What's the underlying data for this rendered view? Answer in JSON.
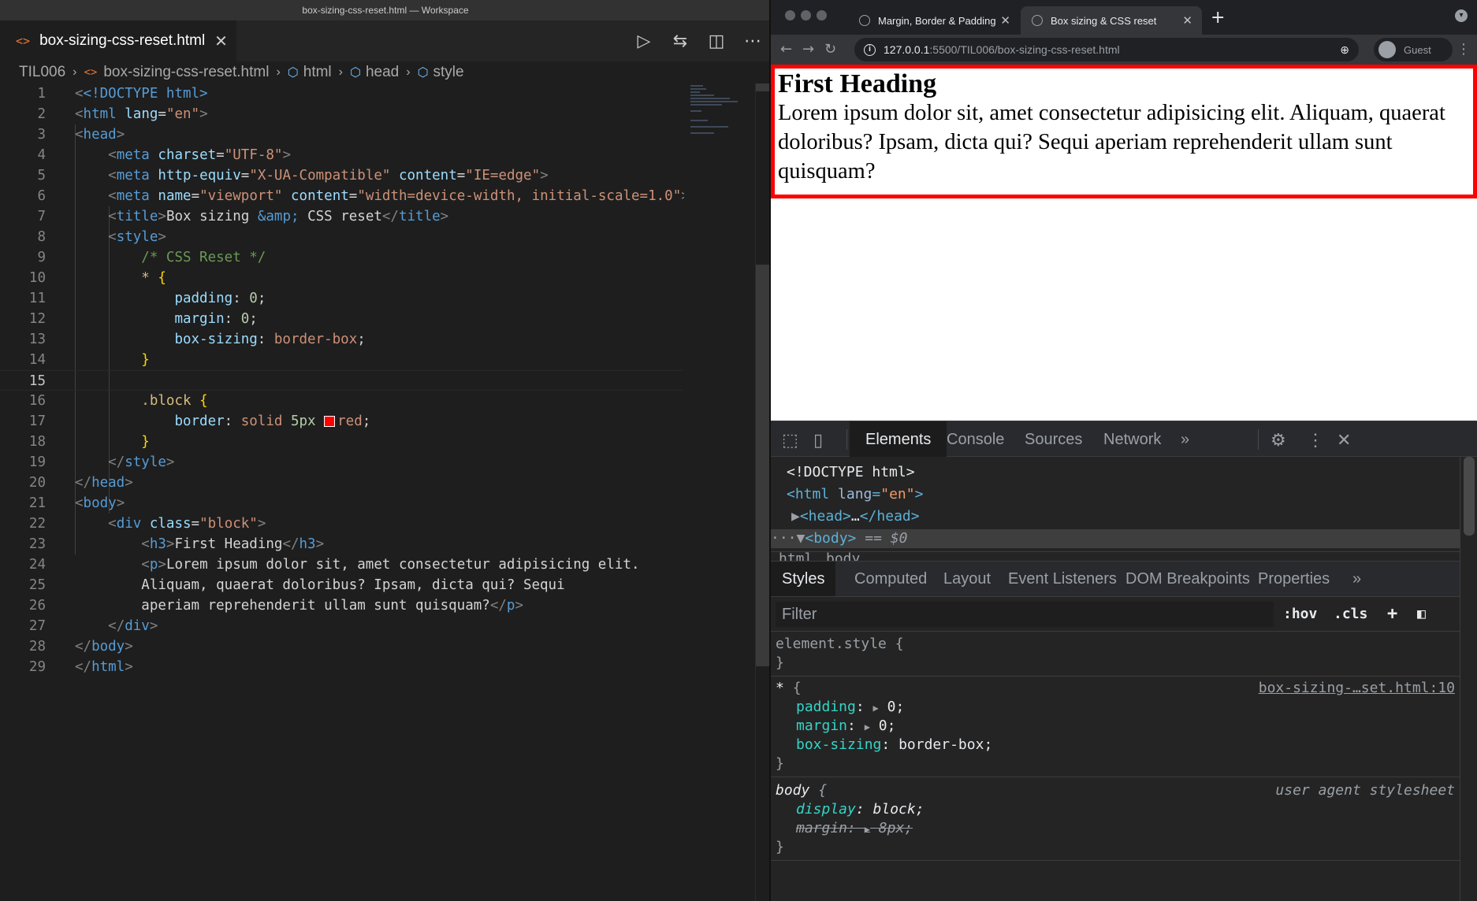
{
  "vscode": {
    "window_title": "box-sizing-css-reset.html — Workspace",
    "tab": {
      "icon": "<>",
      "label": "box-sizing-css-reset.html"
    },
    "breadcrumb": [
      "TIL006",
      "box-sizing-css-reset.html",
      "html",
      "head",
      "style"
    ],
    "current_line": 15,
    "lines": [
      "1",
      "2",
      "3",
      "4",
      "5",
      "6",
      "7",
      "8",
      "9",
      "10",
      "11",
      "12",
      "13",
      "14",
      "15",
      "16",
      "17",
      "18",
      "19",
      "20",
      "21",
      "22",
      "23",
      "24",
      "25",
      "26",
      "27",
      "28",
      "29"
    ],
    "code": {
      "l1": "<!DOCTYPE html>",
      "l2_tag": "html",
      "l2_attr": "lang",
      "l2_val": "\"en\"",
      "l3_tag": "head",
      "l4_attr": "charset",
      "l4_val": "\"UTF-8\"",
      "l5_attr1": "http-equiv",
      "l5_val1": "\"X-UA-Compatible\"",
      "l5_attr2": "content",
      "l5_val2": "\"IE=edge\"",
      "l6_attr1": "name",
      "l6_val1": "\"viewport\"",
      "l6_attr2": "content",
      "l6_val2": "\"width=device-width, initial-scale=1.0\"",
      "l7_text": "Box sizing ",
      "l7_ent": "&amp;",
      "l7_text2": " CSS reset",
      "l9": "/* CSS Reset */",
      "l10": "*",
      "l11_prop": "padding",
      "l11_val": "0",
      "l12_prop": "margin",
      "l12_val": "0",
      "l13_prop": "box-sizing",
      "l13_val": "border-box",
      "l16": ".block",
      "l17_prop": "border",
      "l17_v1": "solid",
      "l17_v2": "5px",
      "l17_v3": "red",
      "l22_attr": "class",
      "l22_val": "\"block\"",
      "l23": "First Heading",
      "l24": "Lorem ipsum dolor sit, amet consectetur adipisicing elit.",
      "l25": "Aliquam, quaerat doloribus? Ipsam, dicta qui? Sequi",
      "l26": "aperiam reprehenderit ullam sunt quisquam?"
    }
  },
  "chrome": {
    "tabs": [
      {
        "label": "Margin, Border & Padding"
      },
      {
        "label": "Box sizing & CSS reset"
      }
    ],
    "url_host": "127.0.0.1",
    "url_path": ":5500/TIL006/box-sizing-css-reset.html",
    "profile": "Guest",
    "page": {
      "heading": "First Heading",
      "paragraph": "Lorem ipsum dolor sit, amet consectetur adipisicing elit. Aliquam, quaerat doloribus? Ipsam, dicta qui? Sequi aperiam reprehenderit ullam sunt quisquam?"
    }
  },
  "devtools": {
    "tabs": [
      "Elements",
      "Console",
      "Sources",
      "Network"
    ],
    "more": "»",
    "dom": {
      "doctype": "<!DOCTYPE html>",
      "body_marker": "== $0"
    },
    "crumbs": [
      "html",
      "body"
    ],
    "subtabs": [
      "Styles",
      "Computed",
      "Layout",
      "Event Listeners",
      "DOM Breakpoints",
      "Properties"
    ],
    "filter_placeholder": "Filter",
    "hov": ":hov",
    "cls": ".cls",
    "styles": {
      "element_style": "element.style {",
      "rule1_selector": "*",
      "rule1_source": "box-sizing-…set.html:10",
      "rule1_props": [
        {
          "name": "padding",
          "value": "0"
        },
        {
          "name": "margin",
          "value": "0"
        },
        {
          "name": "box-sizing",
          "value": "border-box"
        }
      ],
      "rule2_selector": "body",
      "rule2_source": "user agent stylesheet",
      "rule2_props": [
        {
          "name": "display",
          "value": "block"
        },
        {
          "name": "margin",
          "value": "8px"
        }
      ]
    }
  },
  "colors": {
    "block_border": "#ff0000",
    "vscode_bg": "#1e1e1e",
    "devtools_bg": "#242424"
  }
}
